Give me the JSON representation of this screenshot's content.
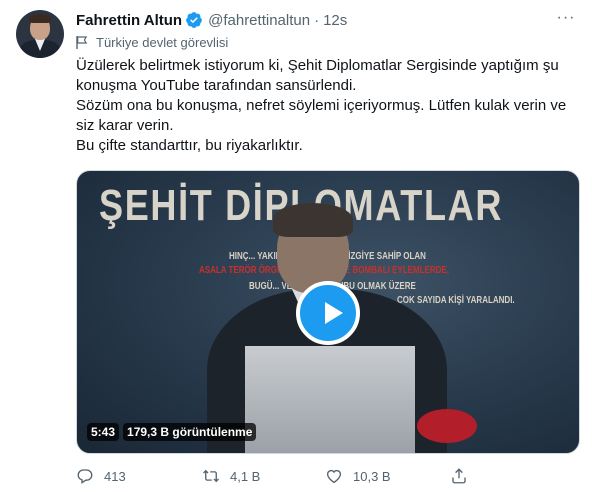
{
  "tweet": {
    "author_name": "Fahrettin Altun",
    "handle": "@fahrettinaltun",
    "separator": "·",
    "time": "12s",
    "more_menu": "···",
    "account_label": "Türkiye devlet görevlisi",
    "text": [
      "Üzülerek belirtmek istiyorum ki, Şehit Diplomatlar Sergisinde yaptığım şu konuşma YouTube tarafından sansürlendi.",
      "Sözüm ona bu konuşma, nefret söylemi içeriyormuş. Lütfen kulak verin ve siz karar verin.",
      "Bu çifte standarttır, bu riyakarlıktır."
    ]
  },
  "video": {
    "banner_title": "ŞEHİT DİPLOMATLAR",
    "banner_lines": [
      "HINÇ... YAKIN AŞIRI SAĞ BİR ÇİZGİYE SAHİP OLAN",
      "ASALA TERÖR ÖRGÜTÜ... SUİKAST VE BOMBALI EYLEMLERDE,",
      "BUGÜ... VE AİLE MENSUBU OLMAK ÜZERE",
      "ÇOK SAYIDA KİŞİ YARALANDI."
    ],
    "duration": "5:43",
    "views": "179,3 B görüntülenme"
  },
  "actions": {
    "replies": "413",
    "retweets": "4,1 B",
    "likes": "10,3 B"
  },
  "colors": {
    "accent": "#1d9bf0",
    "secondary_text": "#536471",
    "primary_text": "#0f1419"
  },
  "icons": [
    "verified-badge-icon",
    "more-icon",
    "flag-icon",
    "play-icon",
    "reply-icon",
    "retweet-icon",
    "like-icon",
    "share-icon"
  ]
}
